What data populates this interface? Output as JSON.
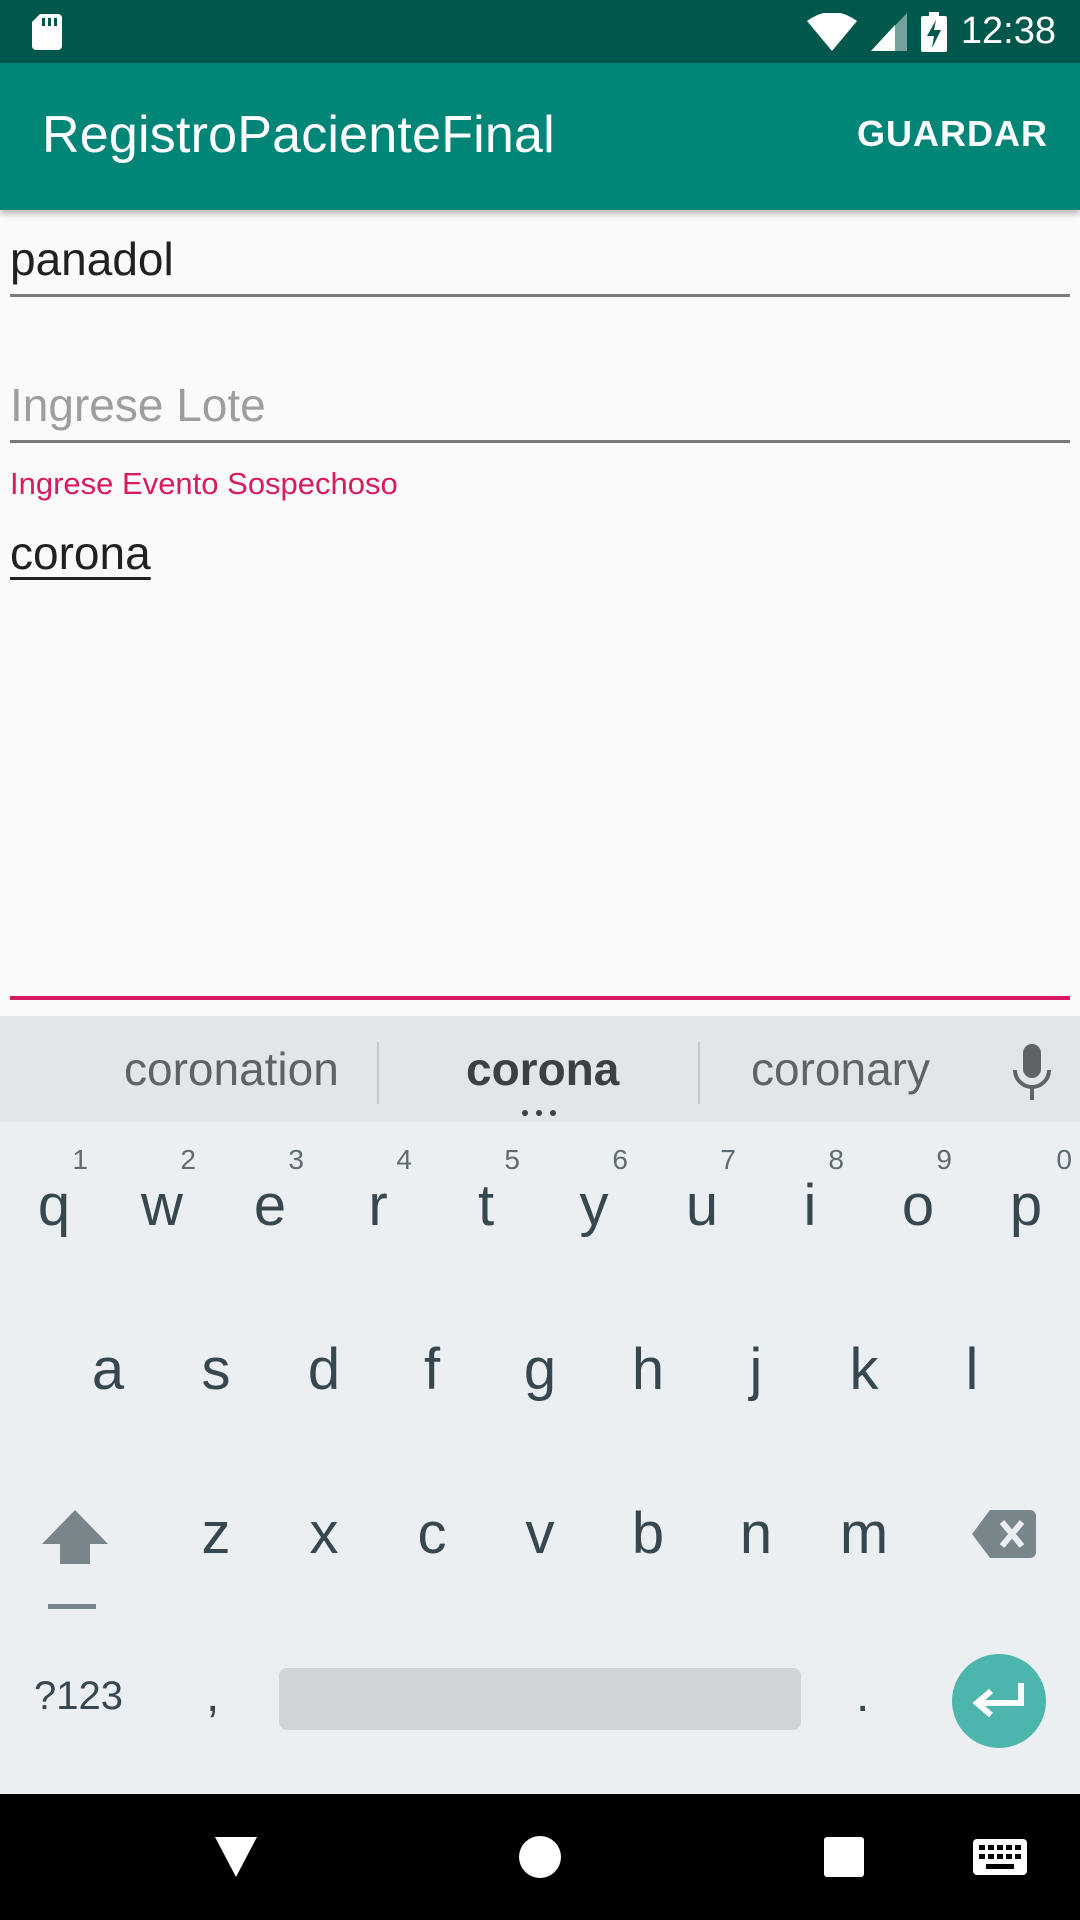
{
  "status_bar": {
    "time": "12:38",
    "icons": [
      "sd-card-icon",
      "wifi-icon",
      "signal-icon",
      "battery-charging-icon"
    ]
  },
  "app_bar": {
    "title": "RegistroPacienteFinal",
    "action_label": "GUARDAR"
  },
  "form": {
    "medicine_value": "panadol",
    "lot_placeholder": "Ingrese Lote",
    "event_label": "Ingrese Evento Sospechoso",
    "event_value": "corona"
  },
  "keyboard": {
    "suggestions": [
      "coronation",
      "corona",
      "coronary"
    ],
    "row1": [
      {
        "key": "q",
        "hint": "1"
      },
      {
        "key": "w",
        "hint": "2"
      },
      {
        "key": "e",
        "hint": "3"
      },
      {
        "key": "r",
        "hint": "4"
      },
      {
        "key": "t",
        "hint": "5"
      },
      {
        "key": "y",
        "hint": "6"
      },
      {
        "key": "u",
        "hint": "7"
      },
      {
        "key": "i",
        "hint": "8"
      },
      {
        "key": "o",
        "hint": "9"
      },
      {
        "key": "p",
        "hint": "0"
      }
    ],
    "row2": [
      "a",
      "s",
      "d",
      "f",
      "g",
      "h",
      "j",
      "k",
      "l"
    ],
    "row3": [
      "z",
      "x",
      "c",
      "v",
      "b",
      "n",
      "m"
    ],
    "symbols_label": "?123",
    "comma_label": ",",
    "period_label": ".",
    "icons": {
      "shift": "shift-icon",
      "backspace": "backspace-icon",
      "enter": "enter-icon",
      "mic": "mic-icon"
    },
    "accent_color": "#4db6ac"
  },
  "nav_bar": {
    "icons": [
      "back-icon",
      "home-icon",
      "recents-icon",
      "keyboard-switch-icon"
    ]
  },
  "colors": {
    "status_bar": "#00574b",
    "app_bar": "#008577",
    "accent": "#d81b60"
  }
}
